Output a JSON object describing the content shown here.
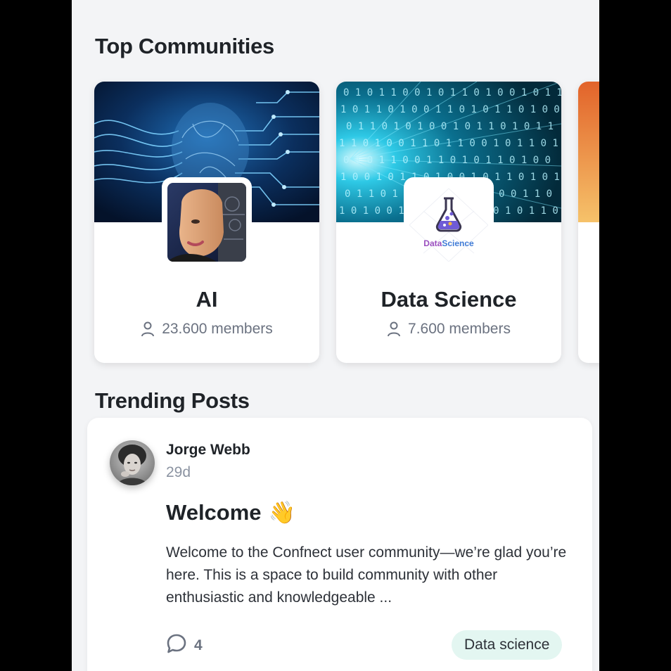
{
  "sections": {
    "top_communities": "Top Communities",
    "trending_posts": "Trending Posts"
  },
  "communities": [
    {
      "name": "AI",
      "members": "23.600 members"
    },
    {
      "name": "Data Science",
      "members": "7.600 members",
      "logo_text_a": "Data",
      "logo_text_b": "Science"
    }
  ],
  "post": {
    "author": "Jorge Webb",
    "time": "29d",
    "title": "Welcome",
    "emoji": "👋",
    "body": "Welcome to the Confnect user community—we’re glad you’re here. This is a space to build community with other enthusiastic and knowledgeable ...",
    "comments": "4",
    "tag": "Data science"
  },
  "colors": {
    "background": "#f3f4f6",
    "tag_bg": "#e3f6f1",
    "text": "#1f2328",
    "muted": "#6b7280"
  },
  "icons": [
    "user-icon",
    "comment-icon",
    "wave-emoji"
  ]
}
